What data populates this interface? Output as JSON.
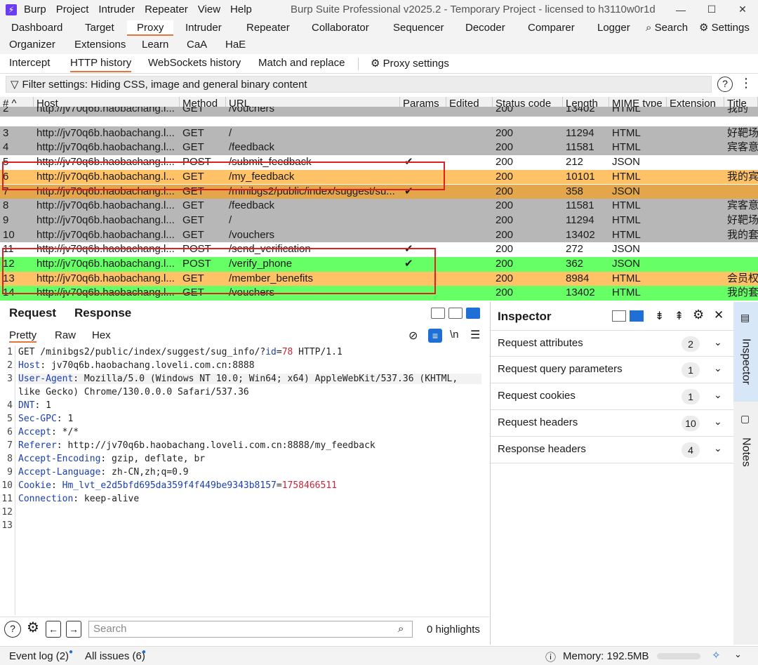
{
  "title_bar": {
    "menu": [
      "Burp",
      "Project",
      "Intruder",
      "Repeater",
      "View",
      "Help"
    ],
    "window_title": "Burp Suite Professional v2025.2 - Temporary Project - licensed to h3110w0r1d"
  },
  "main_tabs": [
    "Dashboard",
    "Target",
    "Proxy",
    "Intruder",
    "Repeater",
    "Collaborator",
    "Sequencer",
    "Decoder",
    "Comparer",
    "Logger"
  ],
  "main_tabs_row2": [
    "Organizer",
    "Extensions",
    "Learn",
    "CaA",
    "HaE"
  ],
  "search_label": "Search",
  "settings_label": "Settings",
  "proxy_tabs": [
    "Intercept",
    "HTTP history",
    "WebSockets history",
    "Match and replace"
  ],
  "proxy_settings_label": "Proxy settings",
  "filter_text": "Filter settings: Hiding CSS, image and general binary content",
  "table": {
    "columns": [
      "#",
      "Host",
      "Method",
      "URL",
      "Params",
      "Edited",
      "Status code",
      "Length",
      "MIME type",
      "Extension",
      "Title"
    ],
    "rows": [
      {
        "num": "2",
        "host": "http://jv70q6b.haobachang.l...",
        "method": "GET",
        "url": "/vouchers",
        "params": "",
        "status": "200",
        "length": "13402",
        "mime": "HTML",
        "title": "我的",
        "bg": "#b7b7b7"
      },
      {
        "num": "3",
        "host": "http://jv70q6b.haobachang.l...",
        "method": "GET",
        "url": "/",
        "params": "",
        "status": "200",
        "length": "11294",
        "mime": "HTML",
        "title": "好靶场",
        "bg": "#b7b7b7"
      },
      {
        "num": "4",
        "host": "http://jv70q6b.haobachang.l...",
        "method": "GET",
        "url": "/feedback",
        "params": "",
        "status": "200",
        "length": "11581",
        "mime": "HTML",
        "title": "宾客意",
        "bg": "#b7b7b7"
      },
      {
        "num": "5",
        "host": "http://jv70q6b.haobachang.l...",
        "method": "POST",
        "url": "/submit_feedback",
        "params": "✔",
        "status": "200",
        "length": "212",
        "mime": "JSON",
        "title": "",
        "bg": "#ffffff"
      },
      {
        "num": "6",
        "host": "http://jv70q6b.haobachang.l...",
        "method": "GET",
        "url": "/my_feedback",
        "params": "",
        "status": "200",
        "length": "10101",
        "mime": "HTML",
        "title": "我的宾",
        "bg": "#ffc266"
      },
      {
        "num": "7",
        "host": "http://jv70q6b.haobachang.l...",
        "method": "GET",
        "url": "/minibgs2/public/index/suggest/su...",
        "params": "✔",
        "status": "200",
        "length": "358",
        "mime": "JSON",
        "title": "",
        "bg": "#e3a64a"
      },
      {
        "num": "8",
        "host": "http://jv70q6b.haobachang.l...",
        "method": "GET",
        "url": "/feedback",
        "params": "",
        "status": "200",
        "length": "11581",
        "mime": "HTML",
        "title": "宾客意",
        "bg": "#b7b7b7"
      },
      {
        "num": "9",
        "host": "http://jv70q6b.haobachang.l...",
        "method": "GET",
        "url": "/",
        "params": "",
        "status": "200",
        "length": "11294",
        "mime": "HTML",
        "title": "好靶场",
        "bg": "#b7b7b7"
      },
      {
        "num": "10",
        "host": "http://jv70q6b.haobachang.l...",
        "method": "GET",
        "url": "/vouchers",
        "params": "",
        "status": "200",
        "length": "13402",
        "mime": "HTML",
        "title": "我的套",
        "bg": "#b7b7b7"
      },
      {
        "num": "11",
        "host": "http://jv70q6b.haobachang.l...",
        "method": "POST",
        "url": "/send_verification",
        "params": "✔",
        "status": "200",
        "length": "272",
        "mime": "JSON",
        "title": "",
        "bg": "#ffffff"
      },
      {
        "num": "12",
        "host": "http://jv70q6b.haobachang.l...",
        "method": "POST",
        "url": "/verify_phone",
        "params": "✔",
        "status": "200",
        "length": "362",
        "mime": "JSON",
        "title": "",
        "bg": "#66ff66"
      },
      {
        "num": "13",
        "host": "http://jv70q6b.haobachang.l...",
        "method": "GET",
        "url": "/member_benefits",
        "params": "",
        "status": "200",
        "length": "8984",
        "mime": "HTML",
        "title": "会员权",
        "bg": "#ffc266"
      },
      {
        "num": "14",
        "host": "http://jv70q6b.haobachang.l...",
        "method": "GET",
        "url": "/vouchers",
        "params": "",
        "status": "200",
        "length": "13402",
        "mime": "HTML",
        "title": "我的套",
        "bg": "#66ff66"
      }
    ]
  },
  "request_tab": "Request",
  "response_tab": "Response",
  "editor_tabs": [
    "Pretty",
    "Raw",
    "Hex"
  ],
  "newline_label": "\\n",
  "request_lines": [
    {
      "n": "1",
      "parts": [
        [
          "t",
          "GET /minibgs2/public/index/suggest/sug_info/?"
        ],
        [
          "k",
          "id"
        ],
        [
          "t",
          "="
        ],
        [
          "v",
          "78"
        ],
        [
          "t",
          " HTTP/1.1"
        ]
      ]
    },
    {
      "n": "2",
      "parts": [
        [
          "k",
          "Host"
        ],
        [
          "t",
          ": jv70q6b.haobachang.loveli.com.cn:8888"
        ]
      ]
    },
    {
      "n": "3",
      "parts": [
        [
          "k",
          "User-Agent"
        ],
        [
          "t",
          ": Mozilla/5.0 (Windows NT 10.0; Win64; x64) AppleWebKit/537.36 (KHTML,"
        ]
      ]
    },
    {
      "n": "",
      "parts": [
        [
          "t",
          "like Gecko) Chrome/130.0.0.0 Safari/537.36"
        ]
      ]
    },
    {
      "n": "4",
      "parts": [
        [
          "k",
          "DNT"
        ],
        [
          "t",
          ": 1"
        ]
      ]
    },
    {
      "n": "5",
      "parts": [
        [
          "k",
          "Sec-GPC"
        ],
        [
          "t",
          ": 1"
        ]
      ]
    },
    {
      "n": "6",
      "parts": [
        [
          "k",
          "Accept"
        ],
        [
          "t",
          ": */*"
        ]
      ]
    },
    {
      "n": "7",
      "parts": [
        [
          "k",
          "Referer"
        ],
        [
          "t",
          ": http://jv70q6b.haobachang.loveli.com.cn:8888/my_feedback"
        ]
      ]
    },
    {
      "n": "8",
      "parts": [
        [
          "k",
          "Accept-Encoding"
        ],
        [
          "t",
          ": gzip, deflate, br"
        ]
      ]
    },
    {
      "n": "9",
      "parts": [
        [
          "k",
          "Accept-Language"
        ],
        [
          "t",
          ": zh-CN,zh;q=0.9"
        ]
      ]
    },
    {
      "n": "10",
      "parts": [
        [
          "k",
          "Cookie"
        ],
        [
          "t",
          ": "
        ],
        [
          "k",
          "Hm_lvt_e2d5bfd695da359f4f449be9343b8157"
        ],
        [
          "t",
          "="
        ],
        [
          "v",
          "1758466511"
        ]
      ]
    },
    {
      "n": "11",
      "parts": [
        [
          "k",
          "Connection"
        ],
        [
          "t",
          ": keep-alive"
        ]
      ]
    },
    {
      "n": "12",
      "parts": []
    },
    {
      "n": "13",
      "parts": []
    }
  ],
  "search_placeholder": "Search",
  "highlights_label": "0 highlights",
  "inspector": {
    "title": "Inspector",
    "rows": [
      {
        "label": "Request attributes",
        "count": "2"
      },
      {
        "label": "Request query parameters",
        "count": "1"
      },
      {
        "label": "Request cookies",
        "count": "1"
      },
      {
        "label": "Request headers",
        "count": "10"
      },
      {
        "label": "Response headers",
        "count": "4"
      }
    ]
  },
  "side_tabs": [
    "Inspector",
    "Notes"
  ],
  "status": {
    "event_log": "Event log (2)",
    "all_issues": "All issues (6)",
    "memory": "Memory: 192.5MB"
  }
}
